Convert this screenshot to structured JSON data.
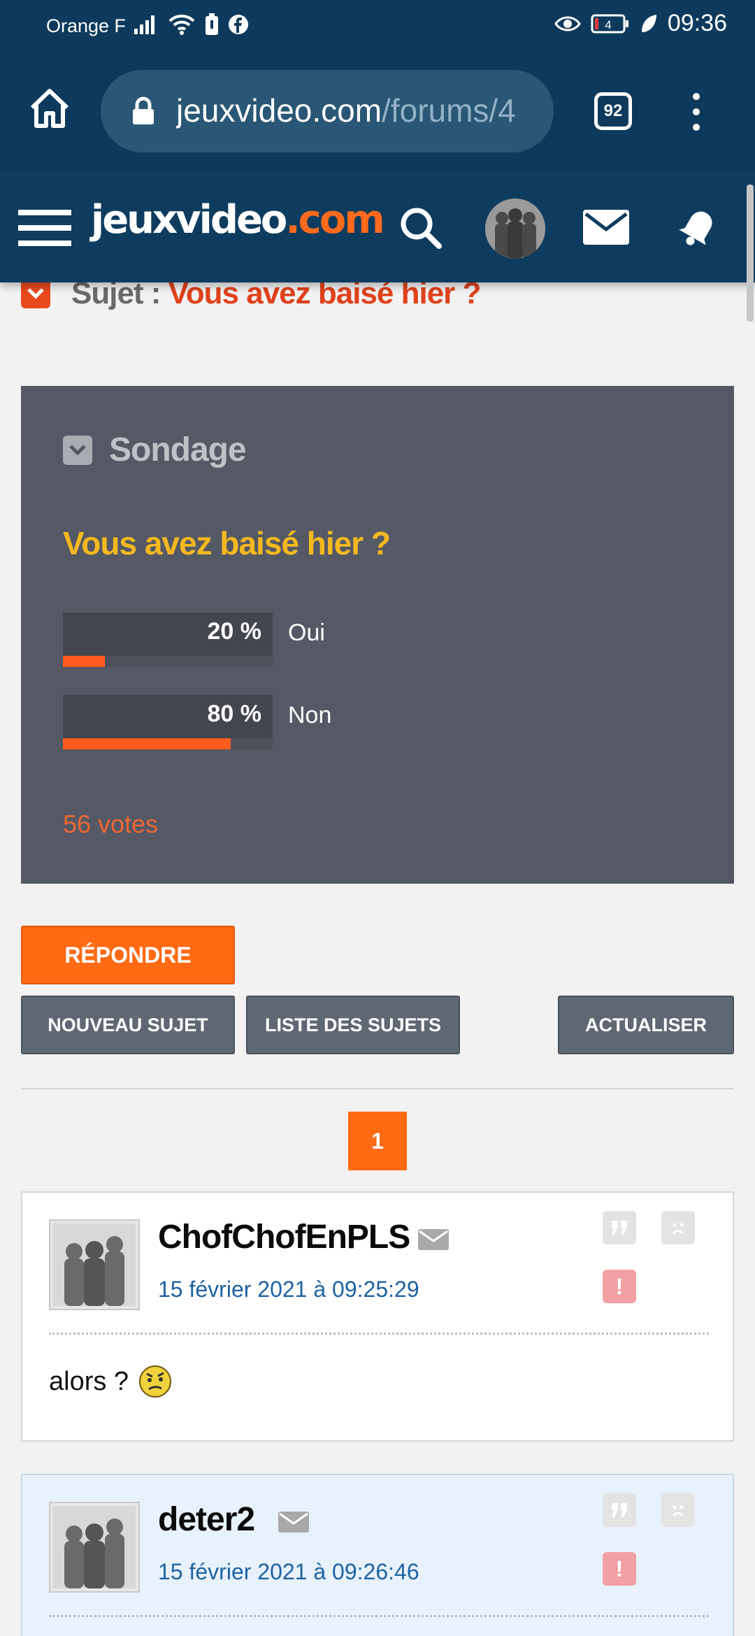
{
  "status_bar": {
    "carrier": "Orange F",
    "battery_level": "4",
    "time": "09:36"
  },
  "browser": {
    "url_main": "jeuxvideo.com",
    "url_path": "/forums/4",
    "tab_count": "92"
  },
  "site_header": {
    "logo_main": "jeuxvideo",
    "logo_suffix": ".com"
  },
  "subject": {
    "prefix": "Sujet : ",
    "title": "Vous avez baisé hier ?"
  },
  "poll": {
    "heading": "Sondage",
    "question": "Vous avez baisé hier ?",
    "options": [
      {
        "label": "Oui",
        "percent_text": "20 %",
        "percent": 20
      },
      {
        "label": "Non",
        "percent_text": "80 %",
        "percent": 80
      }
    ],
    "votes": "56 votes"
  },
  "actions": {
    "reply": "RÉPONDRE",
    "new_topic": "NOUVEAU SUJET",
    "topic_list": "LISTE DES SUJETS",
    "refresh": "ACTUALISER"
  },
  "pagination": {
    "current": "1"
  },
  "messages": [
    {
      "author": "ChofChofEnPLS",
      "date": "15 février 2021 à 09:25:29",
      "body": "alors ?"
    },
    {
      "author": "deter2",
      "date": "15 février 2021 à 09:26:46",
      "body": ""
    }
  ],
  "colors": {
    "header_bg": "#0e3c5f",
    "accent_orange": "#ff6a12",
    "subject_red": "#e0421b",
    "poll_bg": "#545965",
    "poll_question": "#f5b81e",
    "date_blue": "#1d62a3"
  }
}
